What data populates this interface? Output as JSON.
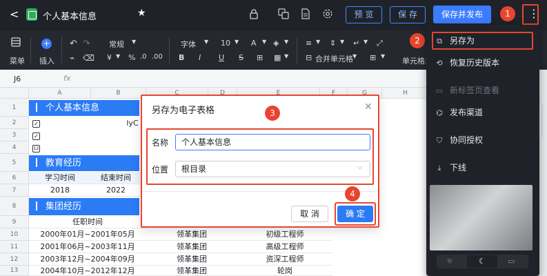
{
  "titlebar": {
    "back": "<",
    "doc_title": "个人基本信息",
    "star": "★",
    "preview_label": "预 览",
    "save_label": "保 存",
    "save_publish_label": "保存并发布",
    "more": "⋮"
  },
  "toolbar": {
    "menu": "菜单",
    "insert": "插入",
    "format": "常规",
    "font": "字体",
    "size": "10",
    "currency": "¥",
    "percent": "%",
    "thousands": "%",
    "bold": "B",
    "italic": "I",
    "underline": "U",
    "strike": "S",
    "merge": "合并单元格",
    "more": "单元格主"
  },
  "formula": {
    "cell_ref": "J6",
    "fx": "fx"
  },
  "sheet": {
    "columns": [
      "A",
      "B",
      "C",
      "D",
      "E",
      "F",
      "G",
      "H"
    ],
    "rows": [
      "1",
      "2",
      "3",
      "4",
      "5",
      "6",
      "7",
      "8",
      "9",
      "10",
      "11",
      "12",
      "13"
    ],
    "band1": "个人基本信息",
    "band2": "教育经历",
    "band3": "集团经历",
    "r2_b": "lyC",
    "r6_a": "学习时间",
    "r6_b": "结束时间",
    "r7_a": "2018",
    "r7_b": "2022",
    "r9_a": "任职时间",
    "r10_a": "2000年01月~2001年05月",
    "r10_c": "领革集团",
    "r10_e": "初级工程师",
    "r11_a": "2001年06月~2003年11月",
    "r11_c": "领革集团",
    "r11_e": "高级工程师",
    "r12_a": "2003年12月~2004年09月",
    "r12_c": "领革集团",
    "r12_e": "资深工程师",
    "r13_a": "2004年10月~2012年12月",
    "r13_c": "领革集团",
    "r13_e": "轮岗"
  },
  "dialog": {
    "title": "另存为电子表格",
    "name_label": "名称",
    "name_value": "个人基本信息",
    "location_label": "位置",
    "location_value": "根目录",
    "cancel": "取 消",
    "confirm": "确 定"
  },
  "menu": {
    "items": [
      {
        "label": "另存为",
        "icon": "copy-icon"
      },
      {
        "label": "恢复历史版本",
        "icon": "history-icon"
      },
      {
        "label": "新标签页查看",
        "icon": "monitor-icon"
      },
      {
        "label": "发布渠道",
        "icon": "share-icon"
      },
      {
        "label": "协同授权",
        "icon": "shield-icon"
      },
      {
        "label": "下线",
        "icon": "offline-icon"
      }
    ]
  },
  "badges": [
    "1",
    "2",
    "3",
    "4"
  ],
  "colors": {
    "accent": "#2b7bf5",
    "highlight": "#e8452f",
    "dark": "#1f2329"
  }
}
